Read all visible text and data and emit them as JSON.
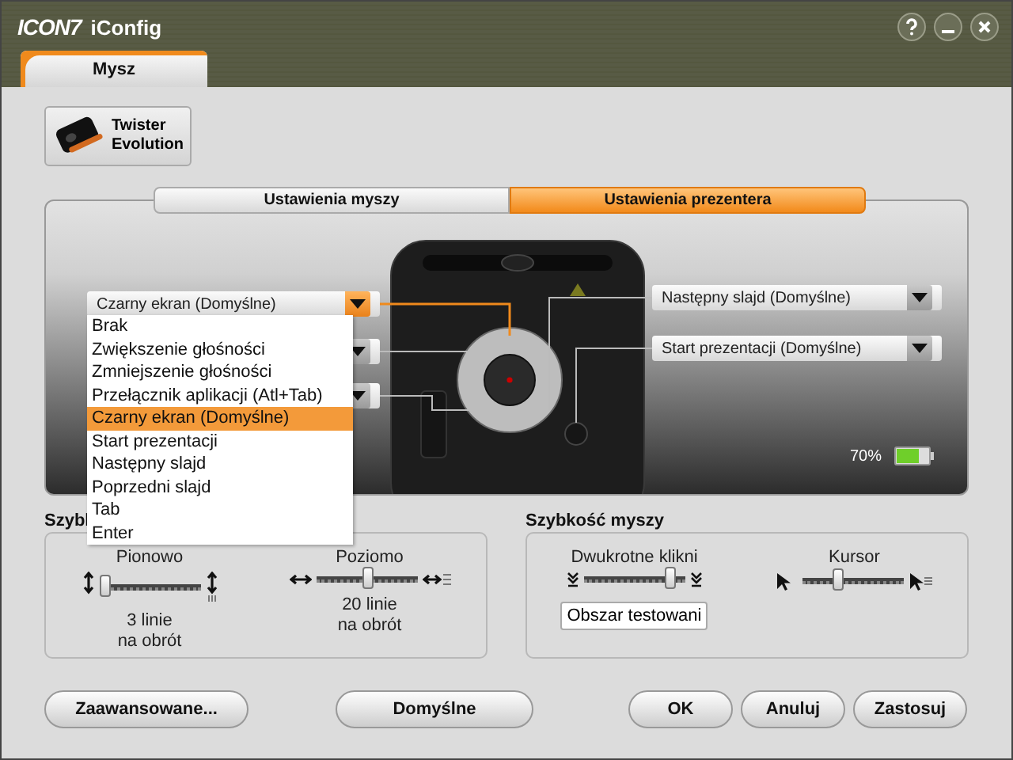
{
  "window": {
    "logo": "ICON7",
    "title": "iConfig"
  },
  "tabs": [
    {
      "label": "Mysz",
      "selected": true
    }
  ],
  "device": {
    "name": "Twister Evolution"
  },
  "subtabs": [
    {
      "label": "Ustawienia myszy",
      "selected": false
    },
    {
      "label": "Ustawienia prezentera",
      "selected": true
    }
  ],
  "left_dropdowns": [
    {
      "value": "Czarny ekran (Domyślne)",
      "open": true,
      "options": [
        {
          "label": "Brak",
          "selected": false
        },
        {
          "label": "Zwiększenie głośności",
          "selected": false
        },
        {
          "label": "Zmniejszenie głośności",
          "selected": false
        },
        {
          "label": "Przełącznik aplikacji (Atl+Tab)",
          "selected": false
        },
        {
          "label": "Czarny ekran (Domyślne)",
          "selected": true
        },
        {
          "label": "Start prezentacji",
          "selected": false
        },
        {
          "label": "Następny slajd",
          "selected": false
        },
        {
          "label": "Poprzedni slajd",
          "selected": false
        },
        {
          "label": "Tab",
          "selected": false
        },
        {
          "label": "Enter",
          "selected": false
        }
      ]
    },
    {
      "open": false
    },
    {
      "open": false
    }
  ],
  "right_dropdowns": [
    {
      "value": "Następny slajd (Domyślne)",
      "open": false
    },
    {
      "value": "Start prezentacji (Domyślne)",
      "open": false
    }
  ],
  "battery": {
    "reading": "70%",
    "level": 0.7
  },
  "scroll_section": {
    "title": "Szybl",
    "sliders": [
      {
        "kind": "vertical",
        "label": "Pionowo",
        "level": 0.05,
        "reading": [
          "3 linie",
          "na obrót"
        ]
      },
      {
        "kind": "horizontal",
        "label": "Poziomo",
        "level": 0.5,
        "reading": [
          "20 linie",
          "na obrót"
        ]
      }
    ]
  },
  "mouse_section": {
    "title": "Szybkość myszy",
    "sliders": [
      {
        "kind": "double-click",
        "label": "Dwukrotne klikni",
        "level": 0.85
      },
      {
        "kind": "cursor",
        "label": "Kursor",
        "level": 0.35
      }
    ],
    "test_area": "Obszar testowani"
  },
  "buttons": [
    {
      "label": "Zaawansowane...",
      "kind": "wide"
    },
    {
      "label": "Domyślne",
      "kind": "wide"
    },
    {
      "label": "OK",
      "kind": "small"
    },
    {
      "label": "Anuluj",
      "kind": "small"
    },
    {
      "label": "Zastosuj",
      "kind": "small"
    }
  ]
}
